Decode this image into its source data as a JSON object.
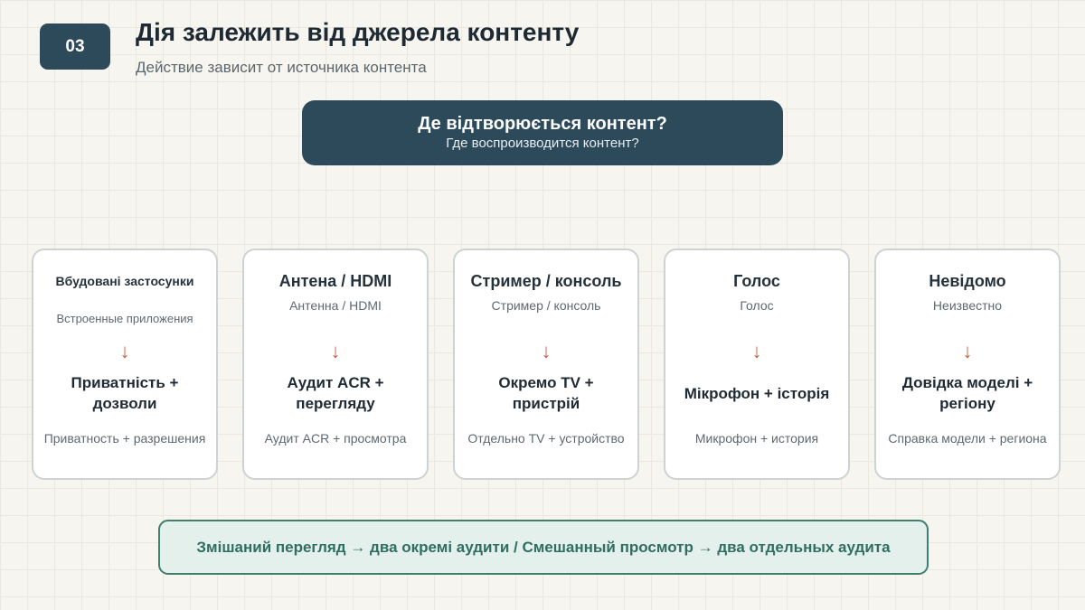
{
  "header": {
    "number": "03",
    "title": "Дія залежить від джерела контенту",
    "subtitle": "Действие зависит от источника контента"
  },
  "question": {
    "main": "Де відтворюється контент?",
    "sub": "Где воспроизводится контент?"
  },
  "arrow": "↓",
  "cards": [
    {
      "title": "Вбудовані застосунки",
      "title_ru": "Встроенные приложения",
      "action": "Приватність + дозволи",
      "action_ru": "Приватность + разрешения"
    },
    {
      "title": "Антена / HDMI",
      "title_ru": "Антенна / HDMI",
      "action": "Аудит ACR + перегляду",
      "action_ru": "Аудит ACR + просмотра"
    },
    {
      "title": "Стример / консоль",
      "title_ru": "Стример / консоль",
      "action": "Окремо TV + пристрій",
      "action_ru": "Отдельно TV + устройство"
    },
    {
      "title": "Голос",
      "title_ru": "Голос",
      "action": "Мікрофон + історія",
      "action_ru": "Микрофон + история"
    },
    {
      "title": "Невідомо",
      "title_ru": "Неизвестно",
      "action": "Довідка моделі + регіону",
      "action_ru": "Справка модели + региона"
    }
  ],
  "footer": {
    "text": "Змішаний перегляд → два окремі аудити / Смешанный просмотр → два отдельных аудита"
  },
  "colors": {
    "primary": "#2c4a5a",
    "accent_arrow": "#c0643f",
    "footer_border": "#3e7f70",
    "footer_bg": "#e4f0ec",
    "background": "#f7f5ef"
  }
}
